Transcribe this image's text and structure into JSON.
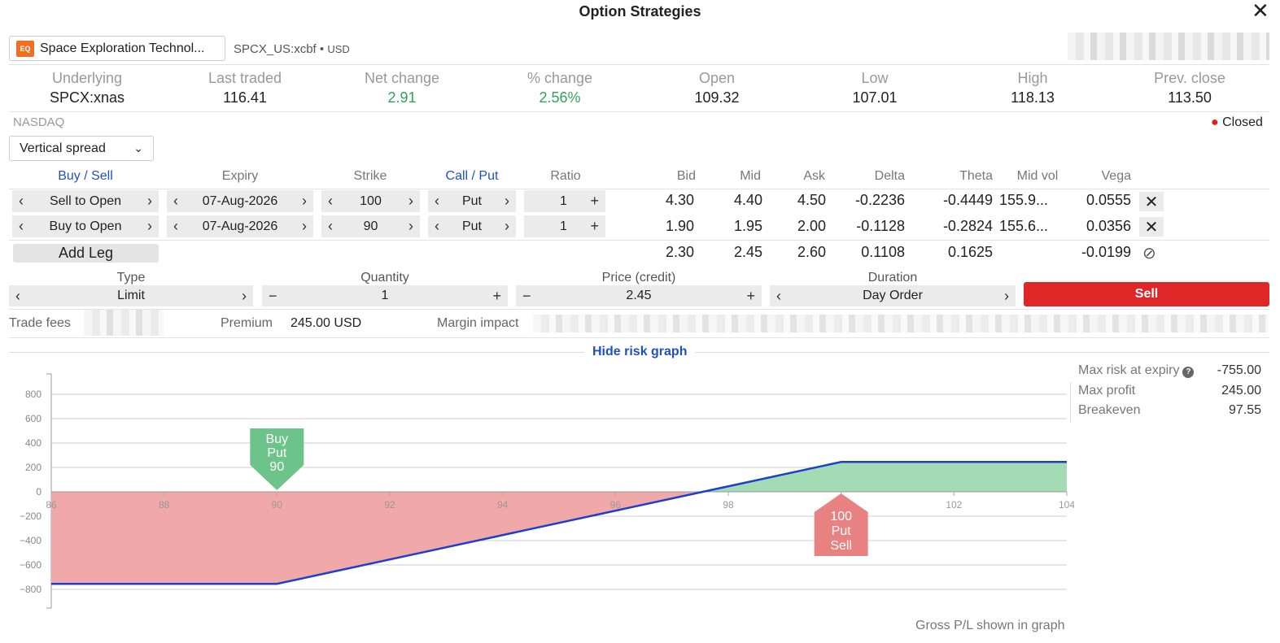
{
  "window": {
    "title": "Option Strategies",
    "close_icon": "close-icon"
  },
  "instrument": {
    "badge": "EQ",
    "name": "Space Exploration Technol...",
    "symbol": "SPCX_US:xcbf",
    "currency": "USD"
  },
  "quotes": [
    {
      "label": "Underlying",
      "value": "SPCX:xnas"
    },
    {
      "label": "Last traded",
      "value": "116.41"
    },
    {
      "label": "Net change",
      "value": "2.91"
    },
    {
      "label": "% change",
      "value": "2.56%"
    },
    {
      "label": "Open",
      "value": "109.32"
    },
    {
      "label": "Low",
      "value": "107.01"
    },
    {
      "label": "High",
      "value": "118.13"
    },
    {
      "label": "Prev. close",
      "value": "113.50"
    }
  ],
  "exchange": "NASDAQ",
  "market_status": "Closed",
  "strategy": "Vertical spread",
  "headers": {
    "buy_sell": "Buy / Sell",
    "expiry": "Expiry",
    "strike": "Strike",
    "call_put": "Call / Put",
    "ratio": "Ratio",
    "bid": "Bid",
    "mid": "Mid",
    "ask": "Ask",
    "delta": "Delta",
    "theta": "Theta",
    "midvol": "Mid vol",
    "vega": "Vega"
  },
  "legs": [
    {
      "side": "Sell to Open",
      "expiry": "07-Aug-2026",
      "strike": "100",
      "type": "Put",
      "ratio": "1",
      "bid": "4.30",
      "mid": "4.40",
      "ask": "4.50",
      "delta": "-0.2236",
      "theta": "-0.4449",
      "midvol": "155.9...",
      "vega": "0.0555"
    },
    {
      "side": "Buy to Open",
      "expiry": "07-Aug-2026",
      "strike": "90",
      "type": "Put",
      "ratio": "1",
      "bid": "1.90",
      "mid": "1.95",
      "ask": "2.00",
      "delta": "-0.1128",
      "theta": "-0.2824",
      "midvol": "155.6...",
      "vega": "0.0356"
    }
  ],
  "totals": {
    "add_leg": "Add Leg",
    "bid": "2.30",
    "mid": "2.45",
    "ask": "2.60",
    "delta": "0.1108",
    "theta": "0.1625",
    "vega": "-0.0199"
  },
  "order": {
    "type_label": "Type",
    "type": "Limit",
    "qty_label": "Quantity",
    "qty": "1",
    "price_label": "Price (credit)",
    "price": "2.45",
    "duration_label": "Duration",
    "duration": "Day Order",
    "submit": "Sell"
  },
  "fees": {
    "trade_fees_label": "Trade fees",
    "premium_label": "Premium",
    "premium": "245.00 USD",
    "margin_label": "Margin impact"
  },
  "risk": {
    "toggle": "Hide risk graph",
    "stats": [
      {
        "label": "Max risk at expiry",
        "value": "-755.00",
        "help": "?"
      },
      {
        "label": "Max profit",
        "value": "245.00"
      },
      {
        "label": "Breakeven",
        "value": "97.55"
      }
    ],
    "footer": "Gross P/L shown in graph"
  },
  "chart_data": {
    "type": "line",
    "x_ticks": [
      86,
      88,
      90,
      92,
      94,
      96,
      98,
      100,
      102,
      104
    ],
    "y_ticks": [
      800,
      600,
      400,
      200,
      0,
      -200,
      -400,
      -600,
      -800
    ],
    "xlim": [
      86,
      104
    ],
    "ylim": [
      -950,
      950
    ],
    "series": [
      {
        "points": [
          [
            86,
            -755
          ],
          [
            90,
            -755
          ],
          [
            100,
            245
          ],
          [
            104,
            245
          ]
        ]
      }
    ],
    "breakeven": 97.55,
    "markers": [
      {
        "label_lines": [
          "Buy",
          "Put",
          "90"
        ],
        "x": 90,
        "side": "buy",
        "color": "#6cc48a"
      },
      {
        "label_lines": [
          "100",
          "Put",
          "Sell"
        ],
        "x": 100,
        "side": "sell",
        "color": "#e88282"
      }
    ],
    "colors": {
      "loss": "#f0a8a8",
      "profit": "#a3dbb5",
      "line": "#1d3fcc"
    }
  }
}
